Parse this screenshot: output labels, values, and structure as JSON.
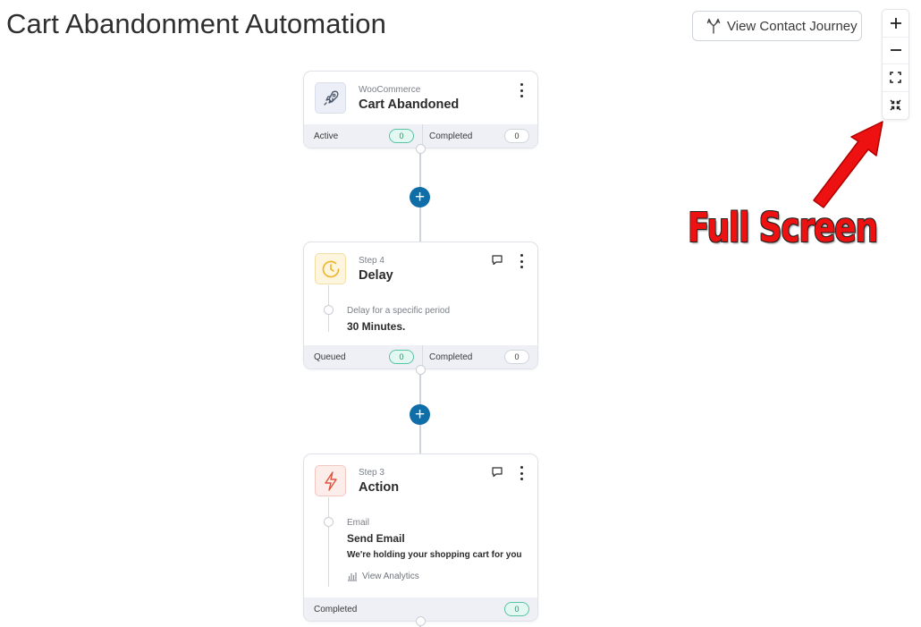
{
  "page": {
    "title": "Cart Abandonment Automation"
  },
  "toolbar": {
    "journey_label": "View Contact Journey",
    "journey_icon": "fork-icon"
  },
  "zoom": [
    {
      "name": "zoom-in-button",
      "icon": "plus-icon"
    },
    {
      "name": "zoom-out-button",
      "icon": "minus-icon"
    },
    {
      "name": "fit-view-button",
      "icon": "fit-screen-icon"
    },
    {
      "name": "full-screen-button",
      "icon": "collapse-icon"
    }
  ],
  "colors": {
    "accent": "#0f6ea8",
    "annotation": "#ee1111",
    "active_pill": "#59c3a5"
  },
  "nodes": {
    "trigger": {
      "sub": "WooCommerce",
      "title": "Cart Abandoned",
      "icon": "rocket-icon",
      "stats": [
        {
          "label": "Active",
          "value": "0"
        },
        {
          "label": "Completed",
          "value": "0"
        }
      ]
    },
    "delay": {
      "sub": "Step 4",
      "title": "Delay",
      "icon": "clock-icon",
      "detail_sub": "Delay for a specific period",
      "detail_main": "30 Minutes.",
      "stats": [
        {
          "label": "Queued",
          "value": "0"
        },
        {
          "label": "Completed",
          "value": "0"
        }
      ]
    },
    "action": {
      "sub": "Step 3",
      "title": "Action",
      "icon": "bolt-icon",
      "detail_sub": "Email",
      "detail_main": "Send Email",
      "detail_text": "We're holding your shopping cart for you",
      "analytics_label": "View Analytics",
      "stats": [
        {
          "label": "Completed",
          "value": "0"
        }
      ]
    }
  },
  "add_button_label": "+",
  "annotation": {
    "label": "Full Screen"
  }
}
